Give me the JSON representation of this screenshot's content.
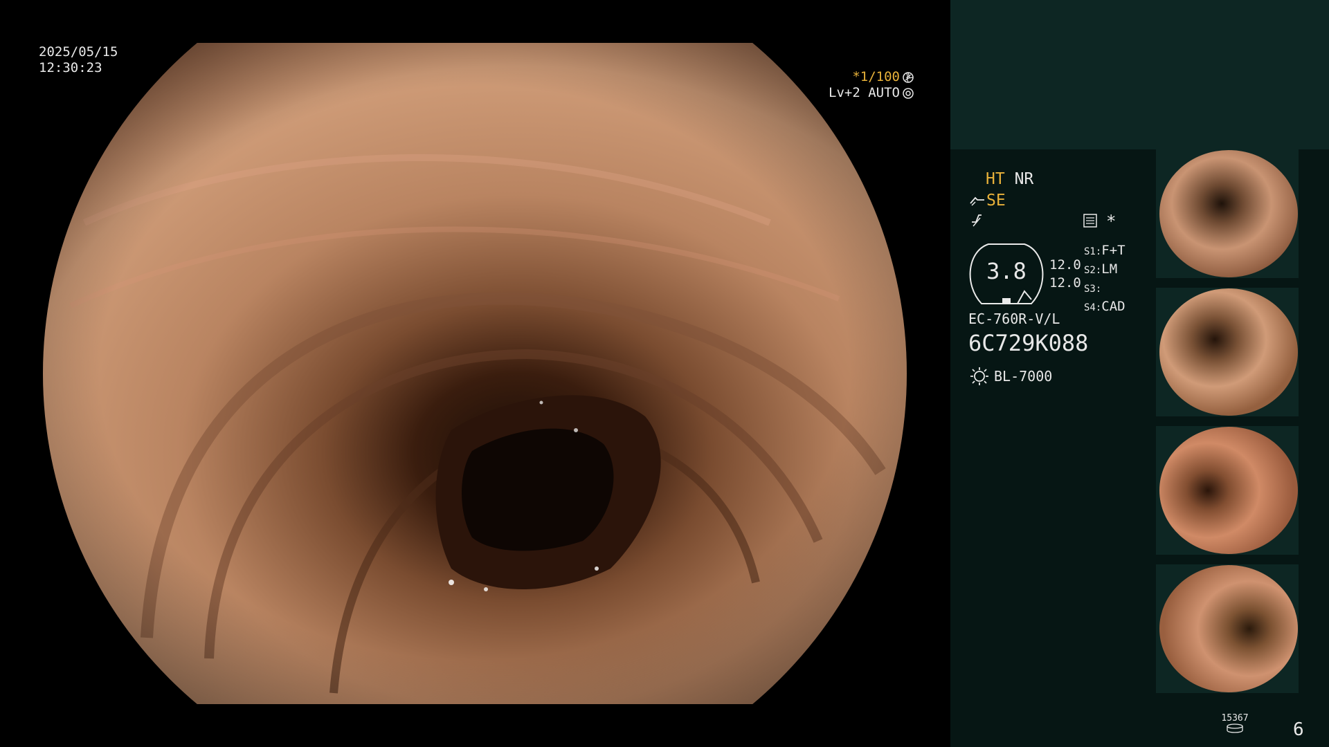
{
  "scope": {
    "date": "2025/05/15",
    "time": "12:30:23",
    "shutter": "*1/100",
    "level": "Lv+2 AUTO"
  },
  "panel": {
    "ht": "HT",
    "nr": "NR",
    "se": "SE",
    "star": "*",
    "zoom_value": "3.8",
    "val1": "12.0",
    "val2": "12.0",
    "s1": "S1:",
    "s1_val": "F+T",
    "s2": "S2:",
    "s2_val": "LM",
    "s3": "S3:",
    "s3_val": "",
    "s4": "S4:",
    "s4_val": "CAD",
    "scope_model": "EC-760R-V/L",
    "serial": "6C729K088",
    "light_source": "BL-7000",
    "storage_count": "15367",
    "image_count": "6"
  },
  "colors": {
    "accent_yellow": "#e9b23a",
    "panel_bg": "#061614",
    "panel_top_bg": "#0d2623",
    "mucosa": "#c89772"
  },
  "icons": {
    "shutter": "aperture-icon",
    "level": "iris-icon",
    "se": "edge-enhance-icon",
    "f": "waveform-icon",
    "record": "record-icon",
    "light": "light-source-icon",
    "storage": "storage-disk-icon"
  }
}
